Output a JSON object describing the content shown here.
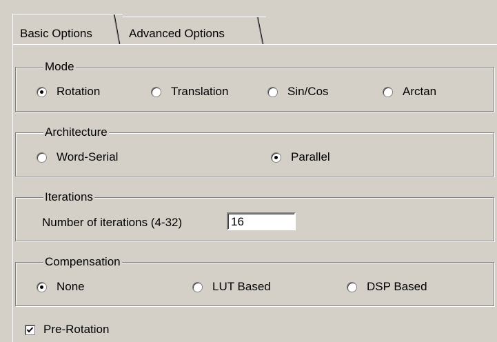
{
  "tabs": {
    "basic_label": "Basic Options",
    "advanced_label": "Advanced Options",
    "active": "Basic Options"
  },
  "mode": {
    "title": "Mode",
    "options": [
      "Rotation",
      "Translation",
      "Sin/Cos",
      "Arctan"
    ],
    "selected": "Rotation"
  },
  "architecture": {
    "title": "Architecture",
    "options": [
      "Word-Serial",
      "Parallel"
    ],
    "selected": "Parallel"
  },
  "iterations": {
    "title": "Iterations",
    "label": "Number of iterations (4-32)",
    "value": "16"
  },
  "compensation": {
    "title": "Compensation",
    "options": [
      "None",
      "LUT Based",
      "DSP Based"
    ],
    "selected": "None"
  },
  "pre_rotation": {
    "label": "Pre-Rotation",
    "checked": true
  },
  "colors": {
    "background": "#d4d0c8",
    "shadow": "#808080",
    "highlight": "#ffffff"
  }
}
